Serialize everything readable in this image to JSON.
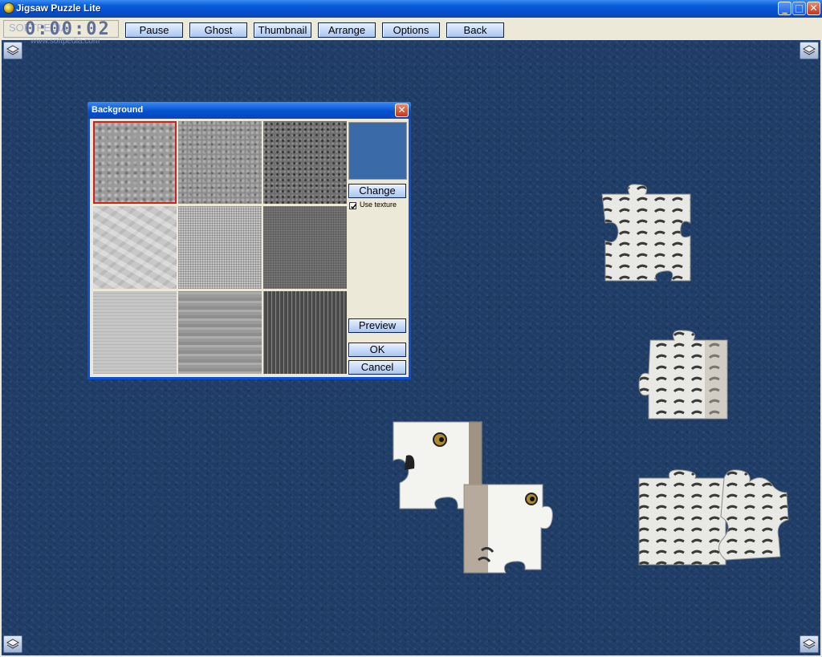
{
  "window": {
    "title": "Jigsaw Puzzle Lite",
    "controls": {
      "minimize": "_",
      "maximize": "□",
      "close": "✕"
    }
  },
  "toolbar": {
    "timer": "0:00:02",
    "timer_watermark": "SOFTPEDIA",
    "watermark_url": "www.softpedia.com",
    "buttons": {
      "pause": "Pause",
      "ghost": "Ghost",
      "thumbnail": "Thumbnail",
      "arrange": "Arrange",
      "options": "Options",
      "back": "Back"
    }
  },
  "board": {
    "color": "#1f3d66",
    "corner_icon": "layers-icon"
  },
  "dialog": {
    "title": "Background",
    "close": "✕",
    "selected_swatch": 0,
    "textures": [
      "stone-light",
      "stone-mid",
      "granite-dark",
      "marble-light",
      "canvas-light",
      "canvas-dark",
      "wood-light",
      "wood-mid",
      "stripes-dark"
    ],
    "preview_color": "#3a6aa8",
    "change_label": "Change",
    "use_texture_label": "Use texture",
    "use_texture_checked": true,
    "preview_label": "Preview",
    "ok_label": "OK",
    "cancel_label": "Cancel"
  },
  "colors": {
    "accent_blue": "#0550d0",
    "selection_red": "#d02020",
    "panel": "#ece9d8"
  }
}
